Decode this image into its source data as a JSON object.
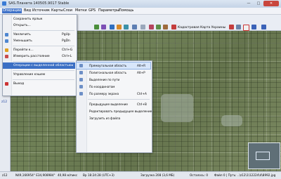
{
  "window": {
    "title": "SAS.Планета 140505.9017 Stable",
    "min": "—",
    "max": "□",
    "close": "✕"
  },
  "menubar": {
    "items": [
      "Операции",
      "Вид",
      "Источник",
      "Карты",
      "Слои",
      "Метки",
      "GPS",
      "Параметры",
      "Помощь"
    ]
  },
  "toolbar": {
    "map_selector_label": "Кадастровая Карта Украины"
  },
  "left_toolbar": {
    "zoom_label": "z12"
  },
  "main_menu": {
    "items": [
      {
        "label": "Сохранить ярлык",
        "shortcut": ""
      },
      {
        "label": "Открыть...",
        "shortcut": ""
      },
      {
        "label": "Увеличить",
        "shortcut": "PgUp"
      },
      {
        "label": "Уменьшить",
        "shortcut": "PgDn"
      },
      {
        "label": "Перейти к...",
        "shortcut": "Ctrl+G"
      },
      {
        "label": "Измерить расстояние",
        "shortcut": "Ctrl+L"
      },
      {
        "label": "Операции с выделенной областью",
        "shortcut": ""
      },
      {
        "label": "Управление кэшем",
        "shortcut": ""
      },
      {
        "label": "Выход",
        "shortcut": ""
      }
    ],
    "submenu_arrow": "▸"
  },
  "submenu": {
    "items": [
      {
        "label": "Прямоугольная область",
        "shortcut": "Alt+R"
      },
      {
        "label": "Полигональная область",
        "shortcut": "Alt+P"
      },
      {
        "label": "Выделение по пути",
        "shortcut": ""
      },
      {
        "label": "По координатам",
        "shortcut": ""
      },
      {
        "label": "По размеру экрана",
        "shortcut": "Ctrl+A"
      },
      {
        "label": "Предыдущее выделение",
        "shortcut": "Ctrl+B"
      },
      {
        "label": "Редактировать предыдущее выделение",
        "shortcut": ""
      },
      {
        "label": "Загрузить из файла",
        "shortcut": ""
      }
    ]
  },
  "statusbar": {
    "zoom": "z12",
    "coords": "N49,166954° E34,908984°",
    "scale": "40,98 м/пикс",
    "time": "Вр 18:24:28 (UTC+3)",
    "queue": "Загрузка 208 (3,6 МБ)",
    "remaining": "Осталось: 0",
    "file": "Файл 0 | Путь: ..\\z12\\1\\12224\\4\\8992.jpg"
  },
  "colors": {
    "accent": "#3b6fc4",
    "titlebar": "#c4d3e6",
    "close_button": "#c9463d"
  }
}
